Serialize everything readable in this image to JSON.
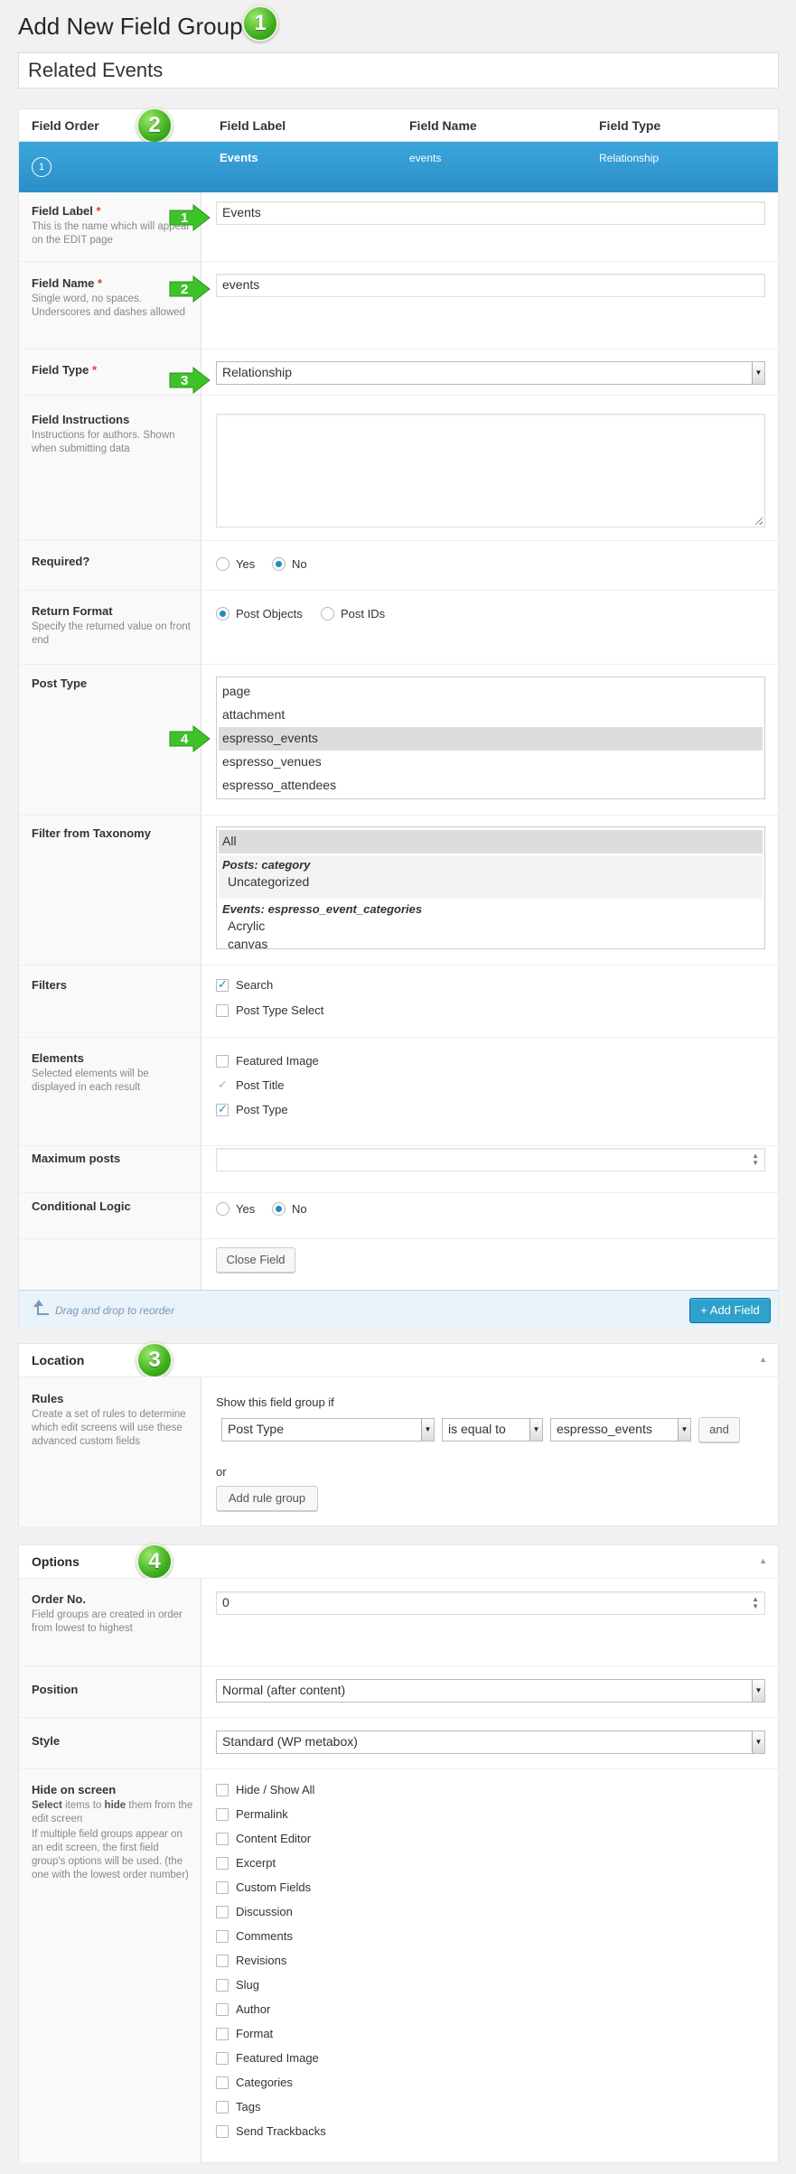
{
  "page_title": "Add New Field Group",
  "group_title": "Related Events",
  "badges": [
    "1",
    "2",
    "3",
    "4"
  ],
  "fields_table": {
    "headers": [
      "Field Order",
      "Field Label",
      "Field Name",
      "Field Type"
    ],
    "row": {
      "order": "1",
      "label": "Events",
      "name": "events",
      "type": "Relationship"
    }
  },
  "callouts": [
    "1",
    "2",
    "3",
    "4"
  ],
  "field_form": {
    "field_label": {
      "label": "Field Label",
      "required": "*",
      "desc": "This is the name which will appear on the EDIT page",
      "value": "Events"
    },
    "field_name": {
      "label": "Field Name",
      "required": "*",
      "desc": "Single word, no spaces. Underscores and dashes allowed",
      "value": "events"
    },
    "field_type": {
      "label": "Field Type",
      "required": "*",
      "value": "Relationship"
    },
    "field_instructions": {
      "label": "Field Instructions",
      "desc": "Instructions for authors. Shown when submitting data",
      "value": ""
    },
    "required": {
      "label": "Required?",
      "options": [
        "Yes",
        "No"
      ],
      "selected": "No"
    },
    "return_format": {
      "label": "Return Format",
      "desc": "Specify the returned value on front end",
      "options": [
        "Post Objects",
        "Post IDs"
      ],
      "selected": "Post Objects"
    },
    "post_type": {
      "label": "Post Type",
      "options": [
        "page",
        "attachment",
        "espresso_events",
        "espresso_venues",
        "espresso_attendees"
      ],
      "selected": "espresso_events"
    },
    "filter_taxonomy": {
      "label": "Filter from Taxonomy",
      "all": "All",
      "group1": "Posts: category",
      "group1_items": [
        "Uncategorized"
      ],
      "group2": "Events: espresso_event_categories",
      "group2_items": [
        "Acrylic",
        "canvas"
      ]
    },
    "filters": {
      "label": "Filters",
      "items": [
        {
          "label": "Search",
          "checked": true
        },
        {
          "label": "Post Type Select",
          "checked": false
        }
      ]
    },
    "elements": {
      "label": "Elements",
      "desc": "Selected elements will be displayed in each result",
      "items": [
        {
          "label": "Featured Image",
          "state": "unchecked"
        },
        {
          "label": "Post Title",
          "state": "disabled-checked"
        },
        {
          "label": "Post Type",
          "state": "checked"
        }
      ]
    },
    "max_posts": {
      "label": "Maximum posts",
      "value": ""
    },
    "conditional_logic": {
      "label": "Conditional Logic",
      "options": [
        "Yes",
        "No"
      ],
      "selected": "No"
    },
    "close_button": "Close Field",
    "drag_hint": "Drag and drop to reorder",
    "add_field": "+ Add Field"
  },
  "location": {
    "title": "Location",
    "rules_label": "Rules",
    "rules_desc": "Create a set of rules to determine which edit screens will use these advanced custom fields",
    "show_if": "Show this field group if",
    "param": "Post Type",
    "operator": "is equal to",
    "value": "espresso_events",
    "and_button": "and",
    "or_label": "or",
    "add_rule_group": "Add rule group"
  },
  "options": {
    "title": "Options",
    "order_no": {
      "label": "Order No.",
      "desc": "Field groups are created in order\nfrom lowest to highest",
      "value": "0"
    },
    "position": {
      "label": "Position",
      "value": "Normal (after content)"
    },
    "style": {
      "label": "Style",
      "value": "Standard (WP metabox)"
    },
    "hide_on_screen": {
      "label": "Hide on screen",
      "desc1_pre": "Select",
      "desc1_mid": " items to ",
      "desc1_bold": "hide",
      "desc1_post": " them from the edit screen",
      "desc2": "If multiple field groups appear on an edit screen, the first field group's options will be used. (the one with the lowest order number)",
      "items": [
        "Hide / Show All",
        "Permalink",
        "Content Editor",
        "Excerpt",
        "Custom Fields",
        "Discussion",
        "Comments",
        "Revisions",
        "Slug",
        "Author",
        "Format",
        "Featured Image",
        "Categories",
        "Tags",
        "Send Trackbacks"
      ]
    }
  },
  "colors": {
    "accent_blue": "#2b8fc7",
    "badge_green": "#3fae1f",
    "required_red": "#dd3d36",
    "button_blue": "#2ea2cc"
  }
}
